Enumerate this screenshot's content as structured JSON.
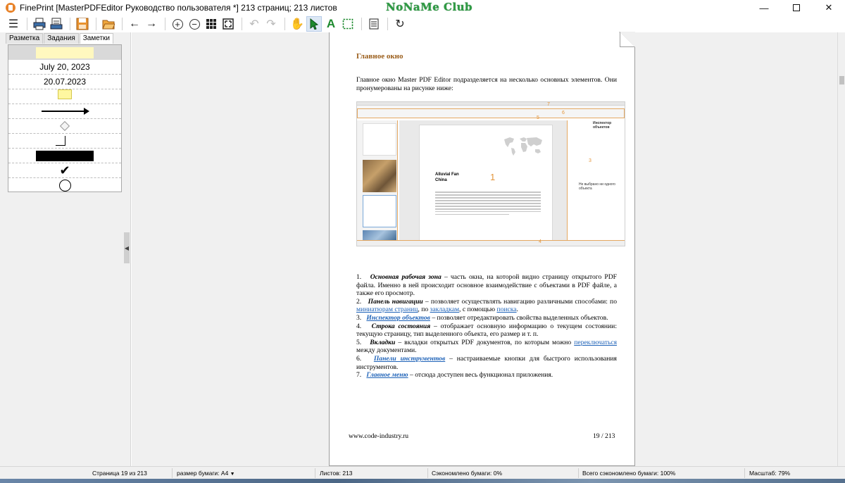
{
  "window": {
    "title": "FinePrint [MasterPDFEditor Руководство пользователя *] 213 страниц; 213 листов",
    "brand": "NoNaMe Club"
  },
  "toolbar": {
    "icons": [
      "menu-icon",
      "print-icon",
      "printer-settings-icon",
      "save-icon",
      "open-folder-icon",
      "back-arrow-icon",
      "forward-arrow-icon",
      "zoom-in-icon",
      "zoom-out-icon",
      "thumbnails-icon",
      "fit-page-icon",
      "undo-icon",
      "redo-icon",
      "hand-icon",
      "pointer-icon",
      "text-tool-icon",
      "selection-tool-icon",
      "document-icon",
      "refresh-icon"
    ]
  },
  "left_panel": {
    "tabs": [
      "Разметка",
      "Задания",
      "Заметки"
    ],
    "selected_tab": "Заметки",
    "notes": {
      "date_1": "July 20, 2023",
      "date_2": "20.07.2023"
    }
  },
  "page": {
    "heading": "Главное окно",
    "intro": "Главное окно Master PDF Editor подразделяется на несколько основных элементов. Они пронумерованы на рисунке ниже:",
    "screenshot": {
      "title_small": "Alluvial Fan",
      "subtitle_small": "China",
      "label_1": "1",
      "label_2": "2",
      "label_3": "3",
      "label_4": "4",
      "label_5": "5",
      "label_6": "6",
      "label_7": "7",
      "inspector_text": "Не выбрано ни одного объекта",
      "inspector_header": "Инспектор объектов"
    },
    "list": [
      {
        "num": "1.",
        "term": "Основная рабочая зона",
        "rest": " – часть окна, на которой видно страницу открытого PDF файла. Именно в ней происходит основное взаимодействие с объектами в PDF файле, а также его просмотр."
      },
      {
        "num": "2.",
        "term": "Панель навигации",
        "rest_a": " – позволяет осуществлять навигацию различными способами: по ",
        "link_a": "миниатюрам страниц",
        "rest_b": ", по ",
        "link_b": "закладкам",
        "rest_c": ", с помощью ",
        "link_c": "поиска",
        "rest_d": "."
      },
      {
        "num": "3.",
        "term": "Инспектор объектов",
        "rest": " – позволяет отредактировать свойства выделенных объектов."
      },
      {
        "num": "4.",
        "term": "Строка состояния",
        "rest": " – отображает основную информацию о текущем состоянии: текущую страницу, тип выделенного объекта, его размер и т. п."
      },
      {
        "num": "5.",
        "term": "Вкладки",
        "rest_a": " – вкладки открытых PDF документов, по которым можно ",
        "link_a": "переключаться",
        "rest_b": " между документами."
      },
      {
        "num": "6.",
        "term": "Панели инструментов",
        "rest": " – настраиваемые кнопки для быстрого использования инструментов."
      },
      {
        "num": "7.",
        "term": "Главное меню",
        "rest": " – отсюда доступен весь функционал приложения."
      }
    ],
    "footer_left": "www.code-industry.ru",
    "footer_right": "19 / 213"
  },
  "statusbar": {
    "page": "Страница 19 из 213",
    "paper": "размер бумаги: A4",
    "sheets": "Листов: 213",
    "saved": "Сэкономлено бумаги: 0%",
    "total_saved": "Всего сэкономлено бумаги: 100%",
    "zoom": "Масштаб: 79%"
  }
}
